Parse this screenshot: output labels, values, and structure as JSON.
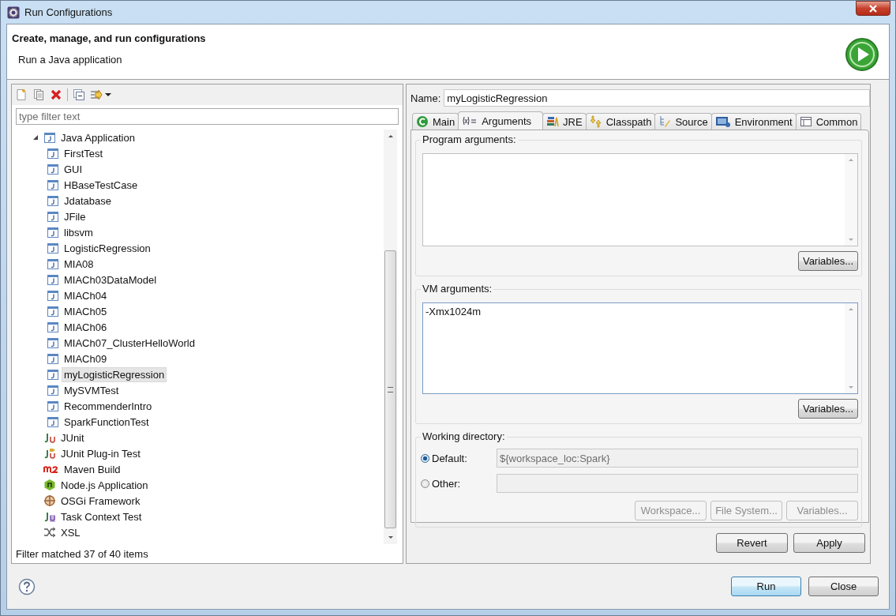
{
  "window": {
    "title": "Run Configurations"
  },
  "header": {
    "title": "Create, manage, and run configurations",
    "message": "Run a Java application"
  },
  "left": {
    "filter": {
      "placeholder": "type filter text"
    },
    "tree": [
      {
        "label": "Java Application",
        "kind": "java",
        "expanded": true,
        "selected": false,
        "children": [
          {
            "label": "FirstTest",
            "kind": "java",
            "selected": false
          },
          {
            "label": "GUI",
            "kind": "java",
            "selected": false
          },
          {
            "label": "HBaseTestCase",
            "kind": "java",
            "selected": false
          },
          {
            "label": "Jdatabase",
            "kind": "java",
            "selected": false
          },
          {
            "label": "JFile",
            "kind": "java",
            "selected": false
          },
          {
            "label": "libsvm",
            "kind": "java",
            "selected": false
          },
          {
            "label": "LogisticRegression",
            "kind": "java",
            "selected": false
          },
          {
            "label": "MIA08",
            "kind": "java",
            "selected": false
          },
          {
            "label": "MIACh03DataModel",
            "kind": "java",
            "selected": false
          },
          {
            "label": "MIACh04",
            "kind": "java",
            "selected": false
          },
          {
            "label": "MIACh05",
            "kind": "java",
            "selected": false
          },
          {
            "label": "MIACh06",
            "kind": "java",
            "selected": false
          },
          {
            "label": "MIACh07_ClusterHelloWorld",
            "kind": "java",
            "selected": false
          },
          {
            "label": "MIACh09",
            "kind": "java",
            "selected": false
          },
          {
            "label": "myLogisticRegression",
            "kind": "java",
            "selected": true
          },
          {
            "label": "MySVMTest",
            "kind": "java",
            "selected": false
          },
          {
            "label": "RecommenderIntro",
            "kind": "java",
            "selected": false
          },
          {
            "label": "SparkFunctionTest",
            "kind": "java",
            "selected": false
          }
        ]
      },
      {
        "label": "JUnit",
        "kind": "junit",
        "selected": false
      },
      {
        "label": "JUnit Plug-in Test",
        "kind": "junit-plugin",
        "selected": false
      },
      {
        "label": "Maven Build",
        "kind": "maven",
        "selected": false
      },
      {
        "label": "Node.js Application",
        "kind": "nodejs",
        "selected": false
      },
      {
        "label": "OSGi Framework",
        "kind": "osgi",
        "selected": false
      },
      {
        "label": "Task Context Test",
        "kind": "task",
        "selected": false
      },
      {
        "label": "XSL",
        "kind": "xsl",
        "selected": false
      }
    ],
    "status": "Filter matched 37 of 40 items"
  },
  "right": {
    "name_label": "Name:",
    "name": "myLogisticRegression",
    "tabs": [
      {
        "label": "Main",
        "kind": "main",
        "selected": false
      },
      {
        "label": "Arguments",
        "kind": "arguments",
        "selected": true
      },
      {
        "label": "JRE",
        "kind": "jre",
        "selected": false
      },
      {
        "label": "Classpath",
        "kind": "classpath",
        "selected": false
      },
      {
        "label": "Source",
        "kind": "source",
        "selected": false
      },
      {
        "label": "Environment",
        "kind": "environment",
        "selected": false
      },
      {
        "label": "Common",
        "kind": "common",
        "selected": false
      }
    ],
    "program_arguments": {
      "label": "Program arguments:",
      "button": "Variables..."
    },
    "vm_arguments": {
      "label": "VM arguments:",
      "value": "-Xmx1024m",
      "button": "Variables..."
    },
    "working_directory": {
      "label": "Working directory:",
      "options": [
        {
          "label": "Default:",
          "selected": true,
          "value": "${workspace_loc:Spark}"
        },
        {
          "label": "Other:",
          "selected": false
        }
      ],
      "buttons": [
        {
          "label": "Workspace...",
          "disabled": true
        },
        {
          "label": "File System...",
          "disabled": true
        },
        {
          "label": "Variables...",
          "disabled": true
        }
      ]
    },
    "actions": [
      {
        "label": "Revert"
      },
      {
        "label": "Apply"
      }
    ]
  },
  "footer": {
    "buttons": [
      {
        "label": "Run",
        "default": true
      },
      {
        "label": "Close",
        "default": false
      }
    ]
  }
}
